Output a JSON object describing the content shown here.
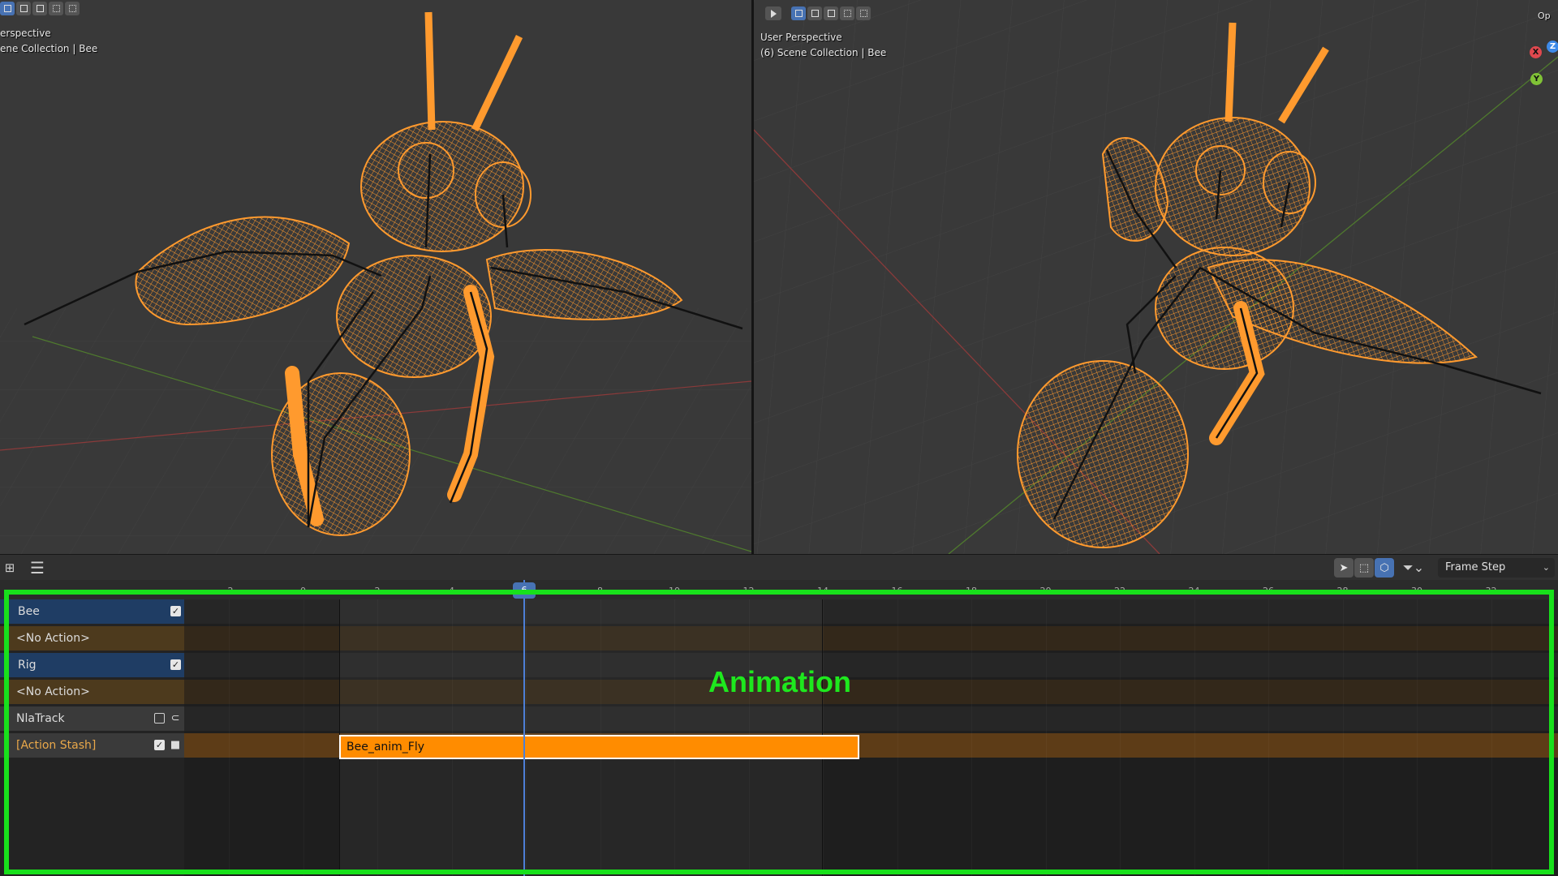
{
  "viewport_left": {
    "line1": "erspective",
    "line2": "ene Collection | Bee"
  },
  "viewport_right": {
    "line1": "User Perspective",
    "line2": "(6) Scene Collection | Bee",
    "gizmo": {
      "x": "X",
      "y": "Y",
      "z": "Z"
    },
    "options_label": "Op"
  },
  "nla_header": {
    "playback_mode": "Frame Step"
  },
  "ruler": {
    "ticks": [
      "-2",
      "0",
      "2",
      "4",
      "6",
      "8",
      "10",
      "12",
      "14",
      "16",
      "18",
      "20",
      "22",
      "24",
      "26",
      "28",
      "30",
      "32"
    ]
  },
  "channels": [
    {
      "label": "Bee",
      "kind": "object",
      "checked": true
    },
    {
      "label": "<No Action>",
      "kind": "action"
    },
    {
      "label": "Rig",
      "kind": "object",
      "checked": true
    },
    {
      "label": "<No Action>",
      "kind": "action"
    },
    {
      "label": "NlaTrack",
      "kind": "track",
      "checked": false
    },
    {
      "label": "[Action Stash]",
      "kind": "stash",
      "checked": true
    }
  ],
  "strip": {
    "label": "Bee_anim_Fly"
  },
  "playhead": {
    "frame": "6"
  },
  "annotation": {
    "text": "Animation"
  },
  "colors": {
    "wireframe": "#ff9a2e",
    "strip": "#ff8c00",
    "highlight": "#18e01b",
    "selection": "#4772b3"
  }
}
